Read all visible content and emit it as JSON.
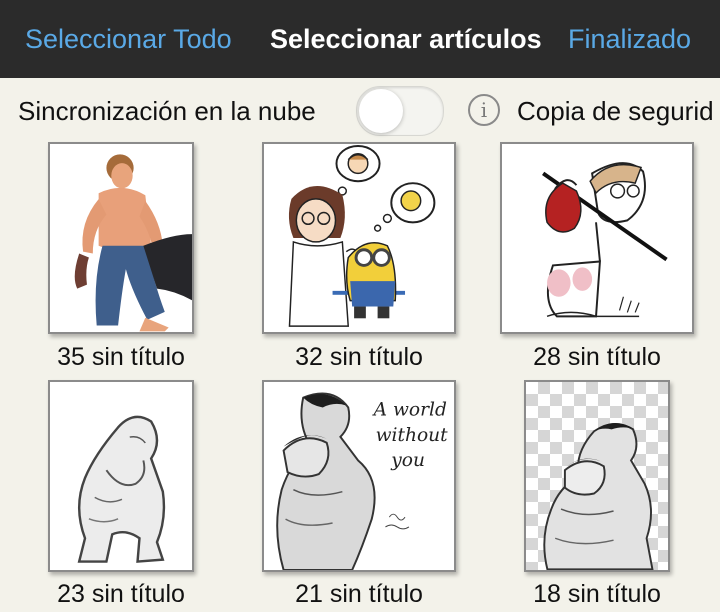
{
  "header": {
    "select_all_label": "Seleccionar Todo",
    "title": "Seleccionar artículos",
    "done_label": "Finalizado"
  },
  "sync": {
    "cloud_sync_label": "Sincronización en la nube",
    "toggle_on": false,
    "info_icon": "info-icon",
    "backup_label": "Copia de segurid"
  },
  "items": [
    {
      "caption": "35 sin título",
      "thumbnail_icon": "kneeling-man-artwork"
    },
    {
      "caption": "32 sin título",
      "thumbnail_icon": "girl-and-minion-artwork"
    },
    {
      "caption": "28 sin título",
      "thumbnail_icon": "bindle-character-artwork"
    },
    {
      "caption": "23 sin título",
      "thumbnail_icon": "crouching-figure-artwork"
    },
    {
      "caption": "21 sin título",
      "thumbnail_icon": "embrace-artwork"
    },
    {
      "caption": "18 sin título",
      "thumbnail_icon": "embrace-transparent-artwork"
    }
  ],
  "artwork_text": {
    "poster_line1": "A world",
    "poster_line2": "without",
    "poster_line3": "you"
  },
  "colors": {
    "header_bg": "#2b2b2b",
    "accent": "#5aa9e6",
    "page_bg": "#f3f2ea"
  }
}
